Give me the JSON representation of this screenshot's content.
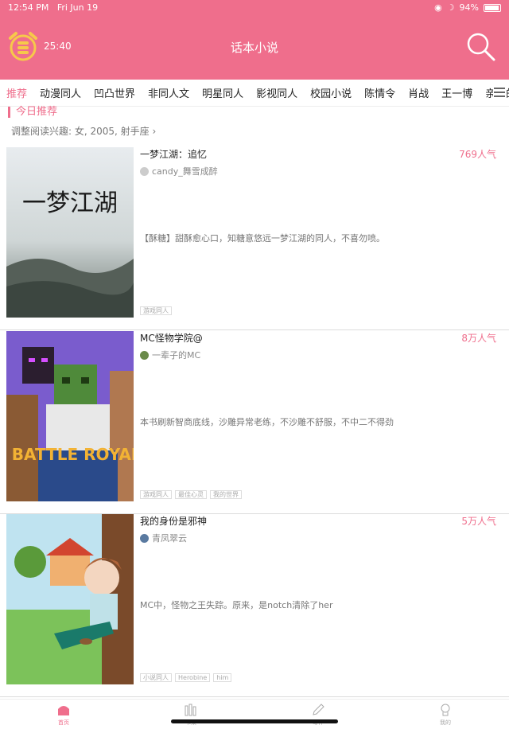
{
  "status": {
    "time": "12:54 PM",
    "date": "Fri Jun 19",
    "battery": "94%"
  },
  "header": {
    "timer": "25:40",
    "title": "话本小说"
  },
  "tabs": [
    "推荐",
    "动漫同人",
    "凹凸世界",
    "非同人文",
    "明星同人",
    "影视同人",
    "校园小说",
    "陈情令",
    "肖战",
    "王一博",
    "亲爱的"
  ],
  "section": {
    "title": "今日推荐",
    "interest": "调整阅读兴趣: 女, 2005, 射手座"
  },
  "books": [
    {
      "title": "一梦江湖：追忆",
      "author": "candy_舞雪成醉",
      "popularity": "769人气",
      "description": "【酥糖】甜酥愈心口，知糖意悠远一梦江湖的同人，不喜勿喷。",
      "tags": [
        "游戏同人"
      ],
      "cover_text": "一梦江湖"
    },
    {
      "title": "MC怪物学院@",
      "author": "一辈子的MC",
      "popularity": "8万人气",
      "description": "本书刷新智商底线，沙雕异常老练，不沙雕不舒服，不中二不得劲",
      "tags": [
        "游戏同人",
        "最佳心灵",
        "我的世界"
      ],
      "cover_text": "BATTLE ROYALE"
    },
    {
      "title": "我的身份是邪神",
      "author": "青凤翠云",
      "popularity": "5万人气",
      "description": "MC中，怪物之王失踪。原来，是notch清除了her",
      "tags": [
        "小说同人",
        "Herobine",
        "him"
      ],
      "cover_text": ""
    }
  ],
  "nav": [
    {
      "label": "首页",
      "icon": "home-icon"
    },
    {
      "label": "书架",
      "icon": "bookshelf-icon"
    },
    {
      "label": "写作",
      "icon": "pen-icon"
    },
    {
      "label": "我的",
      "icon": "profile-icon"
    }
  ],
  "colors": {
    "accent": "#EF6E8C"
  }
}
